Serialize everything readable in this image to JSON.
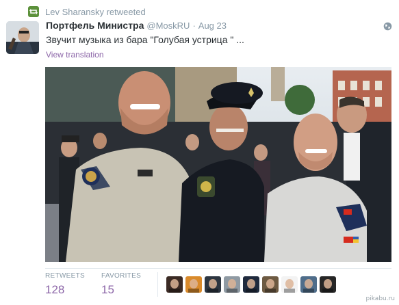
{
  "retweet": {
    "label": "Lev Sharansky retweeted",
    "icon": "retweet-icon",
    "color": "#5c913b"
  },
  "tweet": {
    "fullname": "Портфель Министра",
    "username": "@MoskRU",
    "separator": "·",
    "date": "Aug 23",
    "text": "Звучит музыка из бара \"Голубая устрица \" ...",
    "translate_label": "View translation",
    "globe_icon": "globe-icon"
  },
  "stats": {
    "retweets_label": "RETWEETS",
    "retweets_value": "128",
    "favorites_label": "FAVORITES",
    "favorites_value": "15"
  },
  "favoriters": [
    {
      "color": "#3b2a24"
    },
    {
      "color": "#d98a2b"
    },
    {
      "color": "#2c3540"
    },
    {
      "color": "#8f9aa3"
    },
    {
      "color": "#1f2a3d"
    },
    {
      "color": "#6d5a42"
    },
    {
      "color": "#f3f3f3"
    },
    {
      "color": "#4f6d8a"
    },
    {
      "color": "#262626"
    }
  ],
  "watermark": "pikabu.ru",
  "colors": {
    "link": "#8c66a8",
    "muted": "#8899a6",
    "text": "#292f33"
  }
}
